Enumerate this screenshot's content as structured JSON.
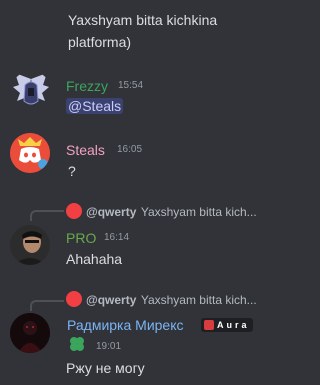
{
  "colors": {
    "background": "#313338",
    "frezzy": "#3ba55d",
    "steals": "#f1a2c4",
    "pro": "#6aa84f",
    "radmirka": "#7bb4f4",
    "mention_bg": "#3c4270",
    "discord_red": "#f23f43"
  },
  "top_message": {
    "line1": "Yaxshyam bitta kichkina",
    "line2": "platforma)"
  },
  "messages": [
    {
      "author": "Frezzy",
      "time": "15:54",
      "text": "@Steals",
      "avatar": "winged-helmet-icon"
    },
    {
      "author": "Steals",
      "time": "16:05",
      "text": "?",
      "avatar": "discord-logo-icon"
    },
    {
      "author": "PRO",
      "time": "16:14",
      "text": "Ahahaha",
      "avatar": "person-photo",
      "reply": {
        "mention": "@qwerty",
        "text": "Yaxshyam bitta kich..."
      }
    },
    {
      "author": "Радмирка Мирекс",
      "badge": "Aura",
      "time": "19:01",
      "text": "Ржу не могу",
      "avatar": "dark-figure-photo",
      "reply": {
        "mention": "@qwerty",
        "text": "Yaxshyam bitta kich..."
      }
    }
  ]
}
